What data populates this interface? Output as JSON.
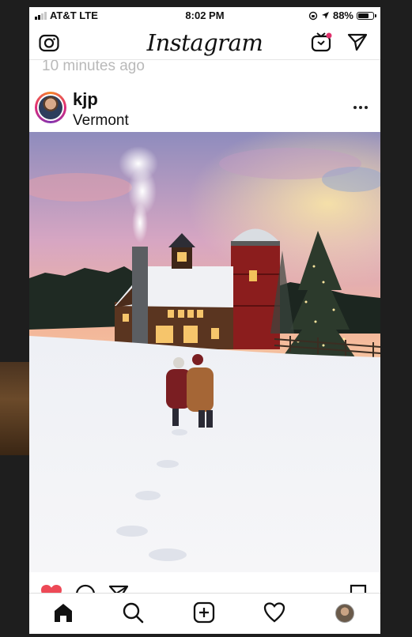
{
  "status_bar": {
    "carrier": "AT&T LTE",
    "time": "8:02 PM",
    "battery_percent": "88%",
    "battery_level": 0.88,
    "signal_bars_filled": 2
  },
  "nav": {
    "wordmark": "Instagram",
    "camera_icon": "camera-icon",
    "igtv_icon": "igtv-icon",
    "direct_icon": "paper-plane-icon"
  },
  "feed": {
    "previous_timestamp": "10 minutes ago"
  },
  "post": {
    "username": "kjp",
    "location": "Vermont"
  },
  "actions": {
    "like_icon": "heart-filled-icon",
    "comment_icon": "comment-icon",
    "share_icon": "paper-plane-icon",
    "save_icon": "bookmark-icon"
  },
  "tabs": [
    "home-icon",
    "search-icon",
    "add-post-icon",
    "activity-heart-icon",
    "profile-avatar"
  ],
  "colors": {
    "like_red": "#ed4956",
    "notification_dot": "#e1306c",
    "timestamp_gray": "#b9b9b9"
  }
}
